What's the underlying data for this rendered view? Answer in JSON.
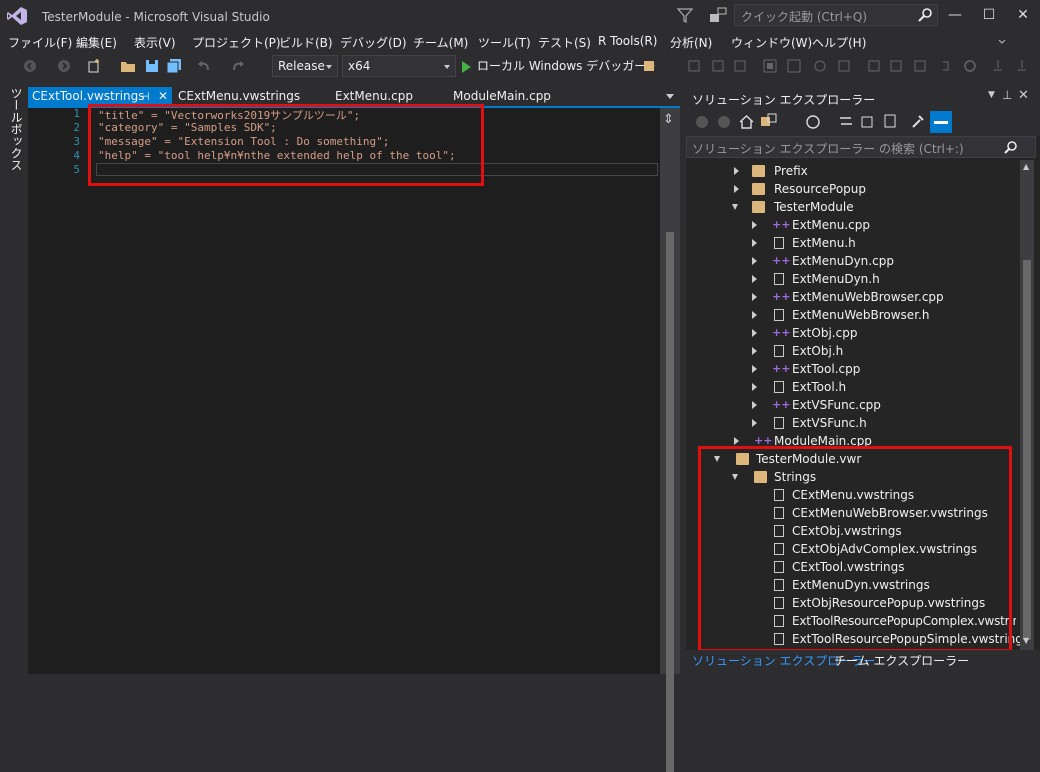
{
  "title_bar": {
    "title": "TesterModule - Microsoft Visual Studio",
    "quick_launch_placeholder": "クイック起動 (Ctrl+Q)",
    "minimize": "—",
    "maximize": "☐",
    "close": "✕"
  },
  "menu": [
    "ファイル(F)",
    "編集(E)",
    "表示(V)",
    "プロジェクト(P)",
    "ビルド(B)",
    "デバッグ(D)",
    "チーム(M)",
    "ツール(T)",
    "テスト(S)",
    "R Tools(R)",
    "分析(N)",
    "ウィンドウ(W)",
    "ヘルプ(H)"
  ],
  "toolbar": {
    "configuration": "Release",
    "platform": "x64",
    "run_label": "ローカル Windows デバッガー"
  },
  "toolbox_label": "ツールボックス",
  "doc_tabs": [
    "CExtTool.vwstrings",
    "CExtMenu.vwstrings",
    "ExtMenu.cpp",
    "ModuleMain.cpp"
  ],
  "editor": {
    "line_numbers": [
      "1",
      "2",
      "3",
      "4",
      "5"
    ],
    "lines": [
      "\"title\" = \"Vectorworks2019サンプルツール\";",
      "\"category\" = \"Samples SDK\";",
      "\"message\" = \"Extension Tool : Do something\";",
      "\"help\" = \"tool help¥n¥nthe extended help of the tool\";",
      ""
    ]
  },
  "solution_explorer": {
    "title": "ソリューション エクスプローラー",
    "search_placeholder": "ソリューション エクスプローラー の検索 (Ctrl+:)",
    "tree": [
      "Prefix",
      "ResourcePopup",
      "TesterModule",
      "ExtMenu.cpp",
      "ExtMenu.h",
      "ExtMenuDyn.cpp",
      "ExtMenuDyn.h",
      "ExtMenuWebBrowser.cpp",
      "ExtMenuWebBrowser.h",
      "ExtObj.cpp",
      "ExtObj.h",
      "ExtTool.cpp",
      "ExtTool.h",
      "ExtVSFunc.cpp",
      "ExtVSFunc.h",
      "ModuleMain.cpp",
      "TesterModule.vwr",
      "Strings",
      "CExtMenu.vwstrings",
      "CExtMenuWebBrowser.vwstrings",
      "CExtObj.vwstrings",
      "CExtObjAdvComplex.vwstrings",
      "CExtTool.vwstrings",
      "ExtMenuDyn.vwstrings",
      "ExtObjResourcePopup.vwstrings",
      "ExtToolResourcePopupComplex.vwstrings",
      "ExtToolResourcePopupSimple.vwstrings"
    ],
    "bottom_tabs": [
      "ソリューション エクスプローラー",
      "チーム エクスプローラー"
    ]
  },
  "colors": {
    "accent": "#007acc",
    "highlight_box": "#e01010",
    "string_literal": "#d69d85",
    "line_number": "#2b91af"
  }
}
